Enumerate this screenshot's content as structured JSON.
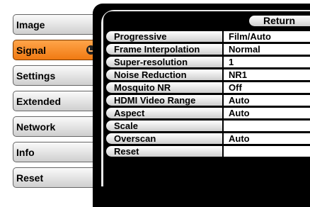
{
  "sidebar": {
    "items": [
      {
        "label": "Image"
      },
      {
        "label": "Signal"
      },
      {
        "label": "Settings"
      },
      {
        "label": "Extended"
      },
      {
        "label": "Network"
      },
      {
        "label": "Info"
      },
      {
        "label": "Reset"
      }
    ],
    "selected_index": 1,
    "selected_color": "#f5892a"
  },
  "panel": {
    "return_label": "Return",
    "rows": [
      {
        "label": "Progressive",
        "value": "Film/Auto"
      },
      {
        "label": "Frame Interpolation",
        "value": "Normal"
      },
      {
        "label": "Super-resolution",
        "value": "1"
      },
      {
        "label": "Noise Reduction",
        "value": "NR1"
      },
      {
        "label": "Mosquito NR",
        "value": "Off"
      },
      {
        "label": "HDMI Video Range",
        "value": "Auto"
      },
      {
        "label": "Aspect",
        "value": "Auto"
      },
      {
        "label": "Scale",
        "value": ""
      },
      {
        "label": "Overscan",
        "value": "Auto"
      },
      {
        "label": "Reset",
        "value": ""
      }
    ]
  }
}
